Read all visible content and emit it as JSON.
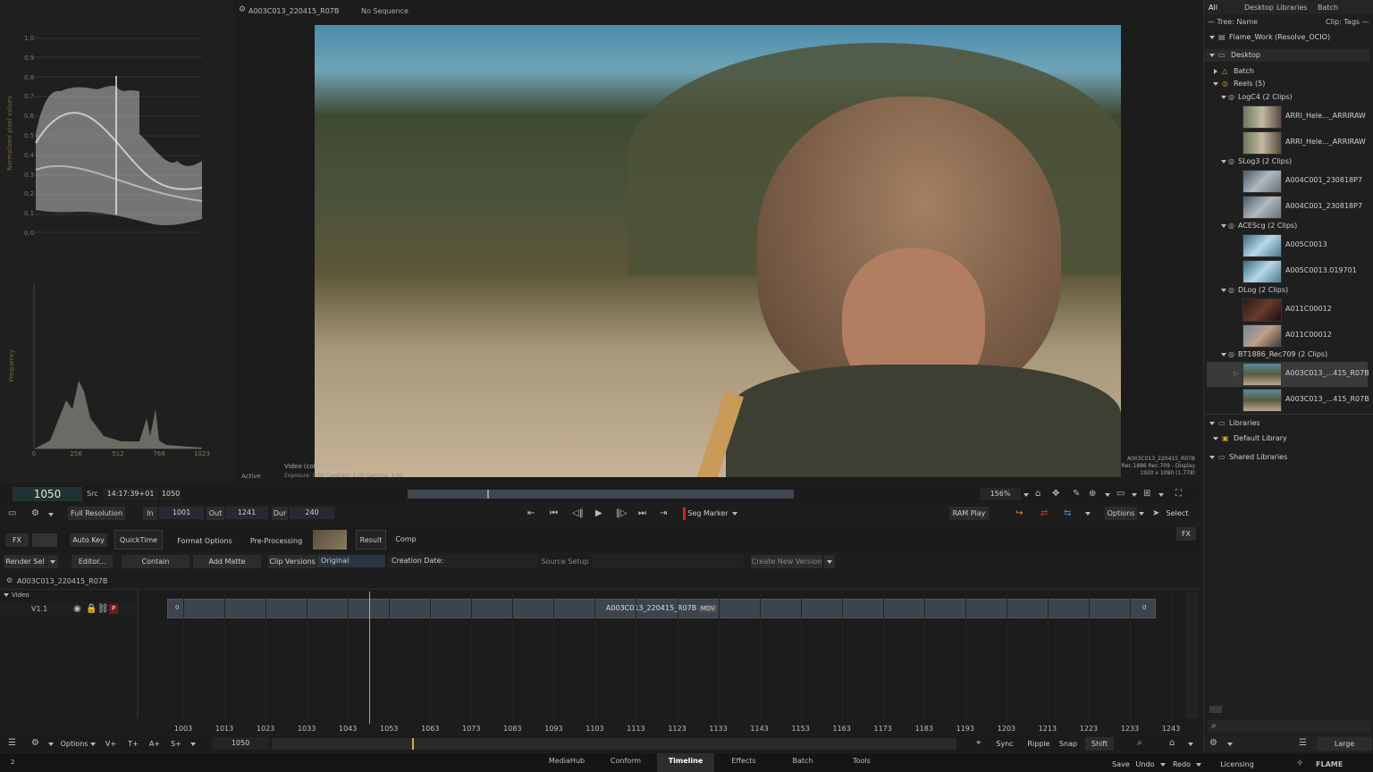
{
  "viewer": {
    "tab_title": "A003C013_220415_R07B",
    "sequence": "No Sequence",
    "status": "Active",
    "overlay_line1": "Video (colorimetric)",
    "overlay_line2": "Exposure: 0.00    Contrast: 1.00    Gamma: 1.00",
    "info_clip": "A003C013_220415_R07B",
    "info_space": "Rec.1886 Rec.709 - Display",
    "info_res": "1920 x 1080 (1.778)",
    "zoom": "156%"
  },
  "scopes": {
    "waveform_ylabel": "Normalized pixel values",
    "waveform_ticks": [
      "1.0",
      "0.9",
      "0.8",
      "0.7",
      "0.6",
      "0.5",
      "0.4",
      "0.3",
      "0.2",
      "0.1",
      "0.0"
    ],
    "histogram_ylabel": "Frequency",
    "histogram_ticks": [
      "0",
      "256",
      "512",
      "768",
      "1023"
    ]
  },
  "transport": {
    "frame": "1050",
    "src_label": "Src",
    "timecode": "14:17:39+01",
    "src_frame": "1050",
    "resolution": "Full Resolution",
    "in_label": "In",
    "in_value": "1001",
    "out_label": "Out",
    "out_value": "1241",
    "dur_label": "Dur",
    "dur_value": "240",
    "seg_marker": "Seg Marker",
    "ram_play": "RAM Play",
    "options": "Options",
    "select": "Select",
    "progress": 0.205
  },
  "toolbar": {
    "fx": "FX",
    "auto_key": "Auto Key",
    "quicktime": "QuickTime",
    "format_options": "Format Options",
    "pre_processing": "Pre-Processing",
    "result": "Result",
    "comp": "Comp",
    "fx_toggle": "FX",
    "render_sel": "Render Sel",
    "editor": "Editor...",
    "contain": "Contain",
    "add_matte": "Add Matte",
    "clip_versions_label": "Clip Versions",
    "clip_versions_value": "Original",
    "creation_date_label": "Creation Date:",
    "source_setup": "Source Setup",
    "create_new_version": "Create New Version"
  },
  "timeline": {
    "clip_name": "A003C013_220415_R07B",
    "section": "Video",
    "track": "V1.1",
    "track_badge": "P",
    "segment_name": "A003C013_220415_R07B",
    "segment_tag": "MOV",
    "segment_start": "0",
    "segment_end": "0",
    "ticks": [
      "1003",
      "1013",
      "1023",
      "1033",
      "1043",
      "1053",
      "1063",
      "1073",
      "1083",
      "1093",
      "1103",
      "1113",
      "1123",
      "1133",
      "1143",
      "1153",
      "1163",
      "1173",
      "1183",
      "1193",
      "1203",
      "1213",
      "1223",
      "1233",
      "1243"
    ],
    "bottom_options": "Options",
    "v_plus": "V+",
    "t_plus": "T+",
    "a_plus": "A+",
    "s_plus": "S+",
    "current": "1050",
    "sync": "Sync",
    "ripple": "Ripple",
    "snap": "Snap",
    "shift": "Shift"
  },
  "nav": {
    "tabs": [
      "MediaHub",
      "Conform",
      "Timeline",
      "Effects",
      "Batch",
      "Tools"
    ],
    "active": "Timeline",
    "save": "Save",
    "undo": "Undo",
    "redo": "Redo",
    "licensing": "Licensing",
    "app": "FLAME",
    "corner": "2"
  },
  "browser": {
    "tabs": [
      "All",
      "Desktop",
      "Libraries",
      "Batch"
    ],
    "tree_label": "— Tree: Name",
    "clip_label": "Clip: Tags —",
    "project": "Flame_Work (Resolve_OCIO)",
    "desktop": "Desktop",
    "batch": "Batch",
    "reels": "Reels (5)",
    "groups": [
      {
        "name": "LogC4 (2 Clips)",
        "clips": [
          "ARRI_Hele..._ARRIRAW",
          "ARRI_Hele..._ARRIRAW"
        ]
      },
      {
        "name": "SLog3 (2 Clips)",
        "clips": [
          "A004C001_230818P7",
          "A004C001_230818P7"
        ]
      },
      {
        "name": "ACEScg (2 Clips)",
        "clips": [
          "A005C0013",
          "A005C0013.019701"
        ]
      },
      {
        "name": "DLog (2 Clips)",
        "clips": [
          "A011C00012",
          "A011C00012"
        ]
      },
      {
        "name": "BT1886_Rec709 (2 Clips)",
        "clips": [
          "A003C013_...415_R07B",
          "A003C013_...415_R07B"
        ]
      }
    ],
    "libraries": "Libraries",
    "default_library": "Default Library",
    "shared_libraries": "Shared Libraries",
    "size": "Large"
  }
}
